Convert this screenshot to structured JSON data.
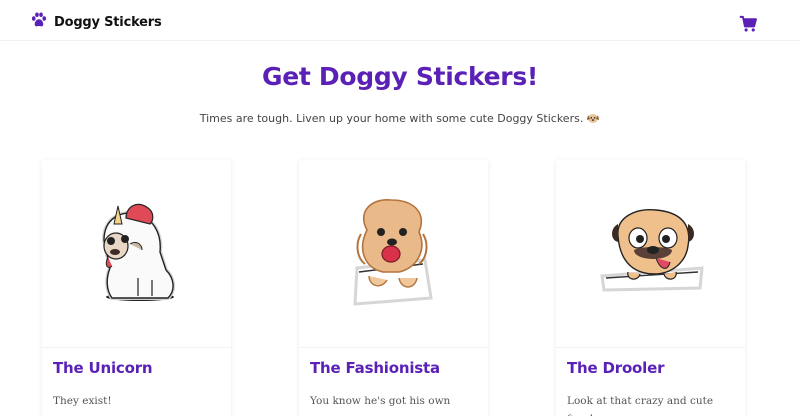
{
  "header": {
    "brand_name": "Doggy Stickers",
    "brand_icon": "paw-icon",
    "cart_icon": "shopping-cart-icon"
  },
  "hero": {
    "title": "Get Doggy Stickers!",
    "subtitle": "Times are tough. Liven up your home with some cute Doggy Stickers."
  },
  "products": [
    {
      "title": "The Unicorn",
      "description": "They exist!",
      "image_icon": "unicorn-pug-sticker"
    },
    {
      "title": "The Fashionista",
      "description": "You know he's got his own",
      "image_icon": "fluffy-dog-sticker"
    },
    {
      "title": "The Drooler",
      "description": "Look at that crazy and cute face!",
      "image_icon": "drooling-pug-sticker"
    }
  ],
  "colors": {
    "accent": "#5b21b6",
    "text": "#444444"
  }
}
